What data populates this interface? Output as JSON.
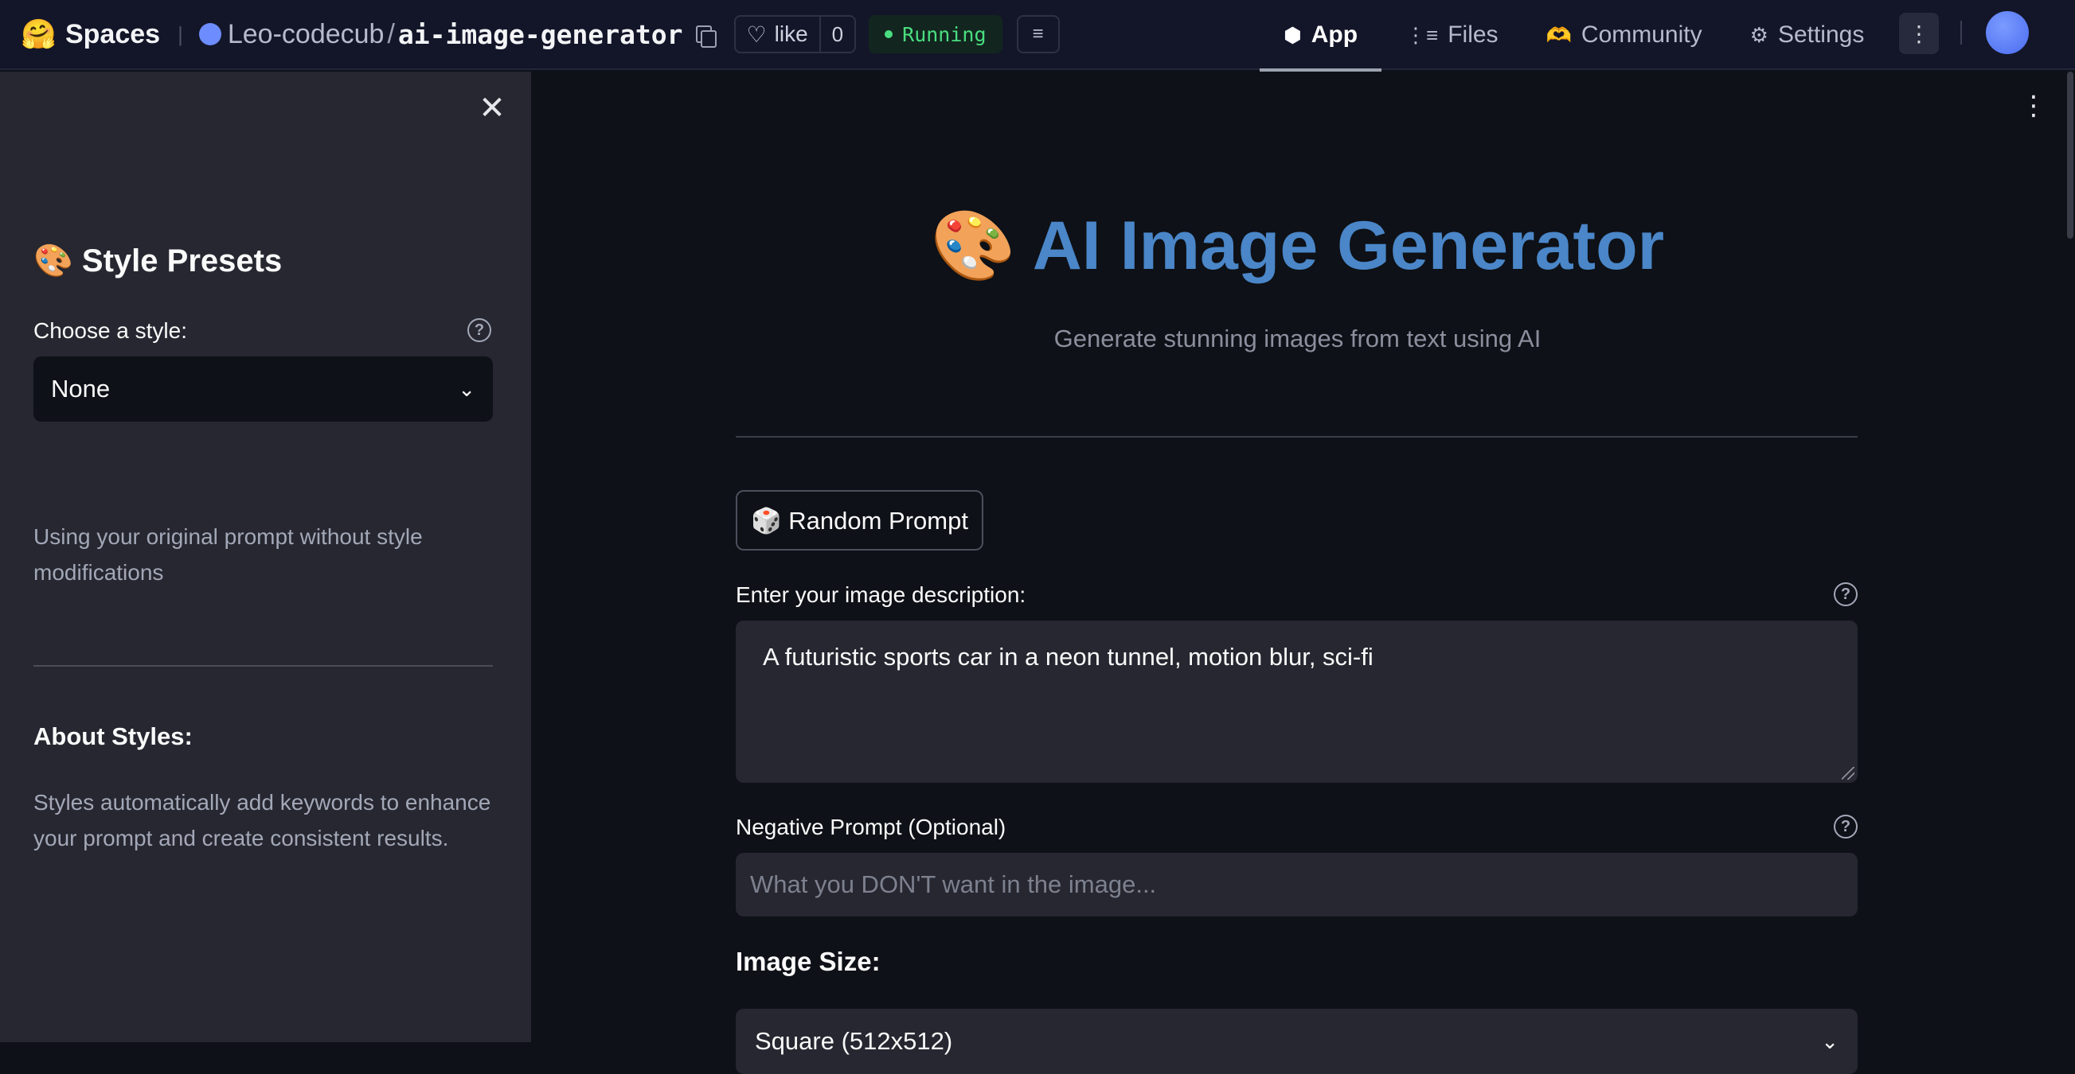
{
  "topbar": {
    "brand": "Spaces",
    "owner": "Leo-codecub",
    "separator": "/",
    "repo": "ai-image-generator",
    "like_label": "like",
    "like_count": "0",
    "status": "Running",
    "status_color": "#4ade80",
    "nav": [
      {
        "label": "App",
        "icon": "cube-icon",
        "active": true
      },
      {
        "label": "Files",
        "icon": "files-icon",
        "active": false
      },
      {
        "label": "Community",
        "icon": "community-icon",
        "active": false
      },
      {
        "label": "Settings",
        "icon": "gear-icon",
        "active": false
      }
    ]
  },
  "sidebar": {
    "title": "🎨 Style Presets",
    "style_label": "Choose a style:",
    "style_value": "None",
    "style_description": "Using your original prompt without style modifications",
    "about_title": "About Styles:",
    "about_text": "Styles automatically add keywords to enhance your prompt and create consistent results."
  },
  "main": {
    "title": "🎨 AI Image Generator",
    "title_color": "#4a86c8",
    "subtitle": "Generate stunning images from text using AI",
    "random_button": "🎲 Random Prompt",
    "prompt_label": "Enter your image description:",
    "prompt_value": "A futuristic sports car in a neon tunnel, motion blur, sci-fi",
    "negative_label": "Negative Prompt (Optional)",
    "negative_placeholder": "What you DON'T want in the image...",
    "size_title": "Image Size:",
    "size_value": "Square (512x512)"
  }
}
